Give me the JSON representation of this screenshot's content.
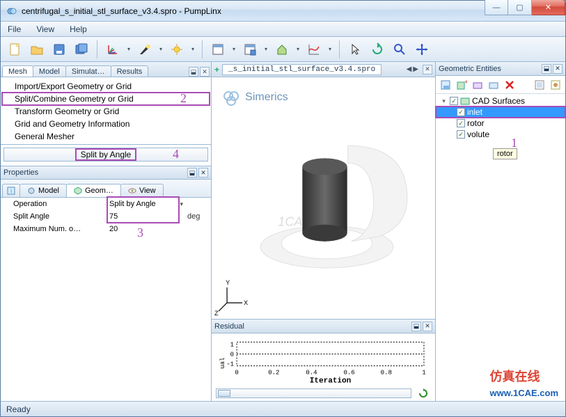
{
  "window": {
    "title": "centrifugal_s_initial_stl_surface_v3.4.spro - PumpLinx",
    "min": "—",
    "max": "▢",
    "close": "✕"
  },
  "menubar": {
    "items": [
      "File",
      "View",
      "Help"
    ]
  },
  "left": {
    "tabs": [
      "Mesh",
      "Model",
      "Simulat…",
      "Results"
    ],
    "active_tab": 0,
    "tree": [
      "Import/Export Geometry or Grid",
      "Split/Combine Geometry or Grid",
      "Transform Geometry or Grid",
      "Grid and Geometry Information",
      "General Mesher"
    ],
    "split_button": "Split by Angle",
    "properties_title": "Properties",
    "prop_tabs": {
      "model": "Model",
      "geom": "Geom…",
      "view": "View"
    },
    "grid": {
      "operation": {
        "label": "Operation",
        "value": "Split by Angle"
      },
      "split_angle": {
        "label": "Split Angle",
        "value": "75",
        "unit": "deg"
      },
      "max_num": {
        "label": "Maximum Num. o…",
        "value": "20"
      }
    }
  },
  "center": {
    "doc_tab_prefix": "+",
    "doc_tab": "_s_initial_stl_surface_v3.4.spro",
    "brand": "Simerics",
    "residual_title": "Residual",
    "iteration_label": "Iteration",
    "axis_y_label": "ual"
  },
  "right": {
    "title": "Geometric Entities",
    "root": "CAD Surfaces",
    "items": [
      "inlet",
      "rotor",
      "volute"
    ],
    "tooltip": "rotor"
  },
  "status": "Ready",
  "annotations": {
    "a1": "1",
    "a2": "2",
    "a3": "3",
    "a4": "4"
  },
  "watermark": {
    "cn": "仿真在线",
    "url": "www.1CAE.com"
  },
  "chart_data": {
    "type": "line",
    "title": "Residual",
    "xlabel": "Iteration",
    "ylabel": "ual",
    "x_ticks": [
      0,
      0.2,
      0.4,
      0.6,
      0.8,
      1
    ],
    "y_ticks": [
      -1,
      0,
      1
    ],
    "xlim": [
      0,
      1
    ],
    "ylim": [
      -1,
      1
    ],
    "series": []
  }
}
